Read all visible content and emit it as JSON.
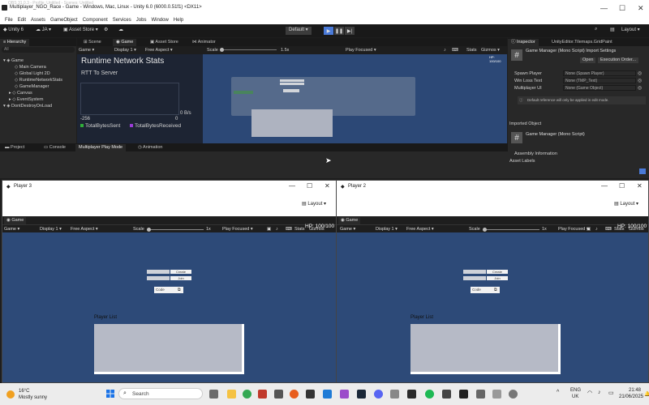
{
  "window": {
    "obs_overlay": "OBS 31.0.3 - Profile: Untitled - Scenes: Untitled",
    "title": "Multiplayer_NGO_Race - Game - Windows, Mac, Linux - Unity 6.0 (6000.0.51f1) <DX11>",
    "minimize": "—",
    "maximize": "☐",
    "close": "✕"
  },
  "menu": [
    "File",
    "Edit",
    "Assets",
    "GameObject",
    "Component",
    "Services",
    "Jobs",
    "Window",
    "Help"
  ],
  "toolbar": {
    "account": "Unity 6",
    "user": "JA",
    "asset_store": "Asset Store",
    "layout_preset": "Default",
    "layout": "Layout"
  },
  "hierarchy": {
    "tab": "Hierarchy",
    "search_placeholder": "All",
    "items": [
      {
        "label": "Game",
        "depth": 0
      },
      {
        "label": "Main Camera",
        "depth": 2
      },
      {
        "label": "Global Light 2D",
        "depth": 2
      },
      {
        "label": "RuntimeNetworkStats",
        "depth": 2
      },
      {
        "label": "GameManager",
        "depth": 2
      },
      {
        "label": "Canvas",
        "depth": 1
      },
      {
        "label": "EventSystem",
        "depth": 1
      },
      {
        "label": "DontDestroyOnLoad",
        "depth": 0
      }
    ]
  },
  "scene_tabs": [
    "Scene",
    "Game",
    "Asset Store",
    "Animator"
  ],
  "game_view": {
    "display_mode": "Game",
    "display": "Display 1",
    "aspect": "Free Aspect",
    "scale_label": "Scale",
    "scale_value": "1.5x",
    "play_focused": "Play Focused",
    "stats": "Stats",
    "gizmos": "Gizmos",
    "hp_small": "HP: 100/100"
  },
  "stats": {
    "title": "Runtime Network Stats",
    "subtitle": "RTT To Server",
    "rate": "0 B/s",
    "y_min": "-256",
    "y_zero": "0",
    "legend": [
      "TotalBytesSent",
      "TotalBytesReceived"
    ],
    "colors": {
      "sent": "#2fae3a",
      "received": "#9b3cd8"
    }
  },
  "inspector": {
    "tabs": [
      "Inspector",
      "UnityEditor.Tilemaps.GridPaint"
    ],
    "component_title": "Game Manager (Mono Script) Import Settings",
    "open_button": "Open",
    "exec_button": "Execution Order...",
    "fields": [
      {
        "label": "Spawn Player",
        "value": "None (Spawn Player)"
      },
      {
        "label": "Win Loss Text",
        "value": "None (TMP_Text)"
      },
      {
        "label": "Multiplayer UI",
        "value": "None (Game Object)"
      }
    ],
    "note": "Default reference will only be applied in edit mode.",
    "imported_object": "Imported Object",
    "imported_title": "Game Manager (Mono Script)",
    "assembly_info": "Assembly Information",
    "asset_labels": "Asset Labels"
  },
  "bottom_tabs": [
    "Project",
    "Console",
    "Multiplayer Play Mode",
    "Animation"
  ],
  "players": [
    {
      "title": "Player 3",
      "tab": "Game",
      "layout": "Layout",
      "display_mode": "Game",
      "display": "Display 1",
      "aspect": "Free Aspect",
      "scale_label": "Scale",
      "scale_value": "1x",
      "play_focused": "Play Focused",
      "stats": "Stats",
      "gizmos": "Gizmos",
      "hp": "HP: 100/100",
      "create": "Create",
      "join": "Join",
      "code_placeholder": "Code",
      "player_list": "Player List"
    },
    {
      "title": "Player 2",
      "tab": "Game",
      "layout": "Layout",
      "display_mode": "Game",
      "display": "Display 1",
      "aspect": "Free Aspect",
      "scale_label": "Scale",
      "scale_value": "1x",
      "play_focused": "Play Focused",
      "stats": "Stats",
      "gizmos": "Gizmos",
      "hp": "HP: 100/100",
      "create": "Create",
      "join": "Join",
      "code_placeholder": "Code",
      "player_list": "Player List"
    }
  ],
  "taskbar": {
    "weather_temp": "16°C",
    "weather_desc": "Mostly sunny",
    "search_placeholder": "Search",
    "lang": "ENG",
    "region": "UK",
    "time": "21:48",
    "date": "21/06/2025"
  }
}
